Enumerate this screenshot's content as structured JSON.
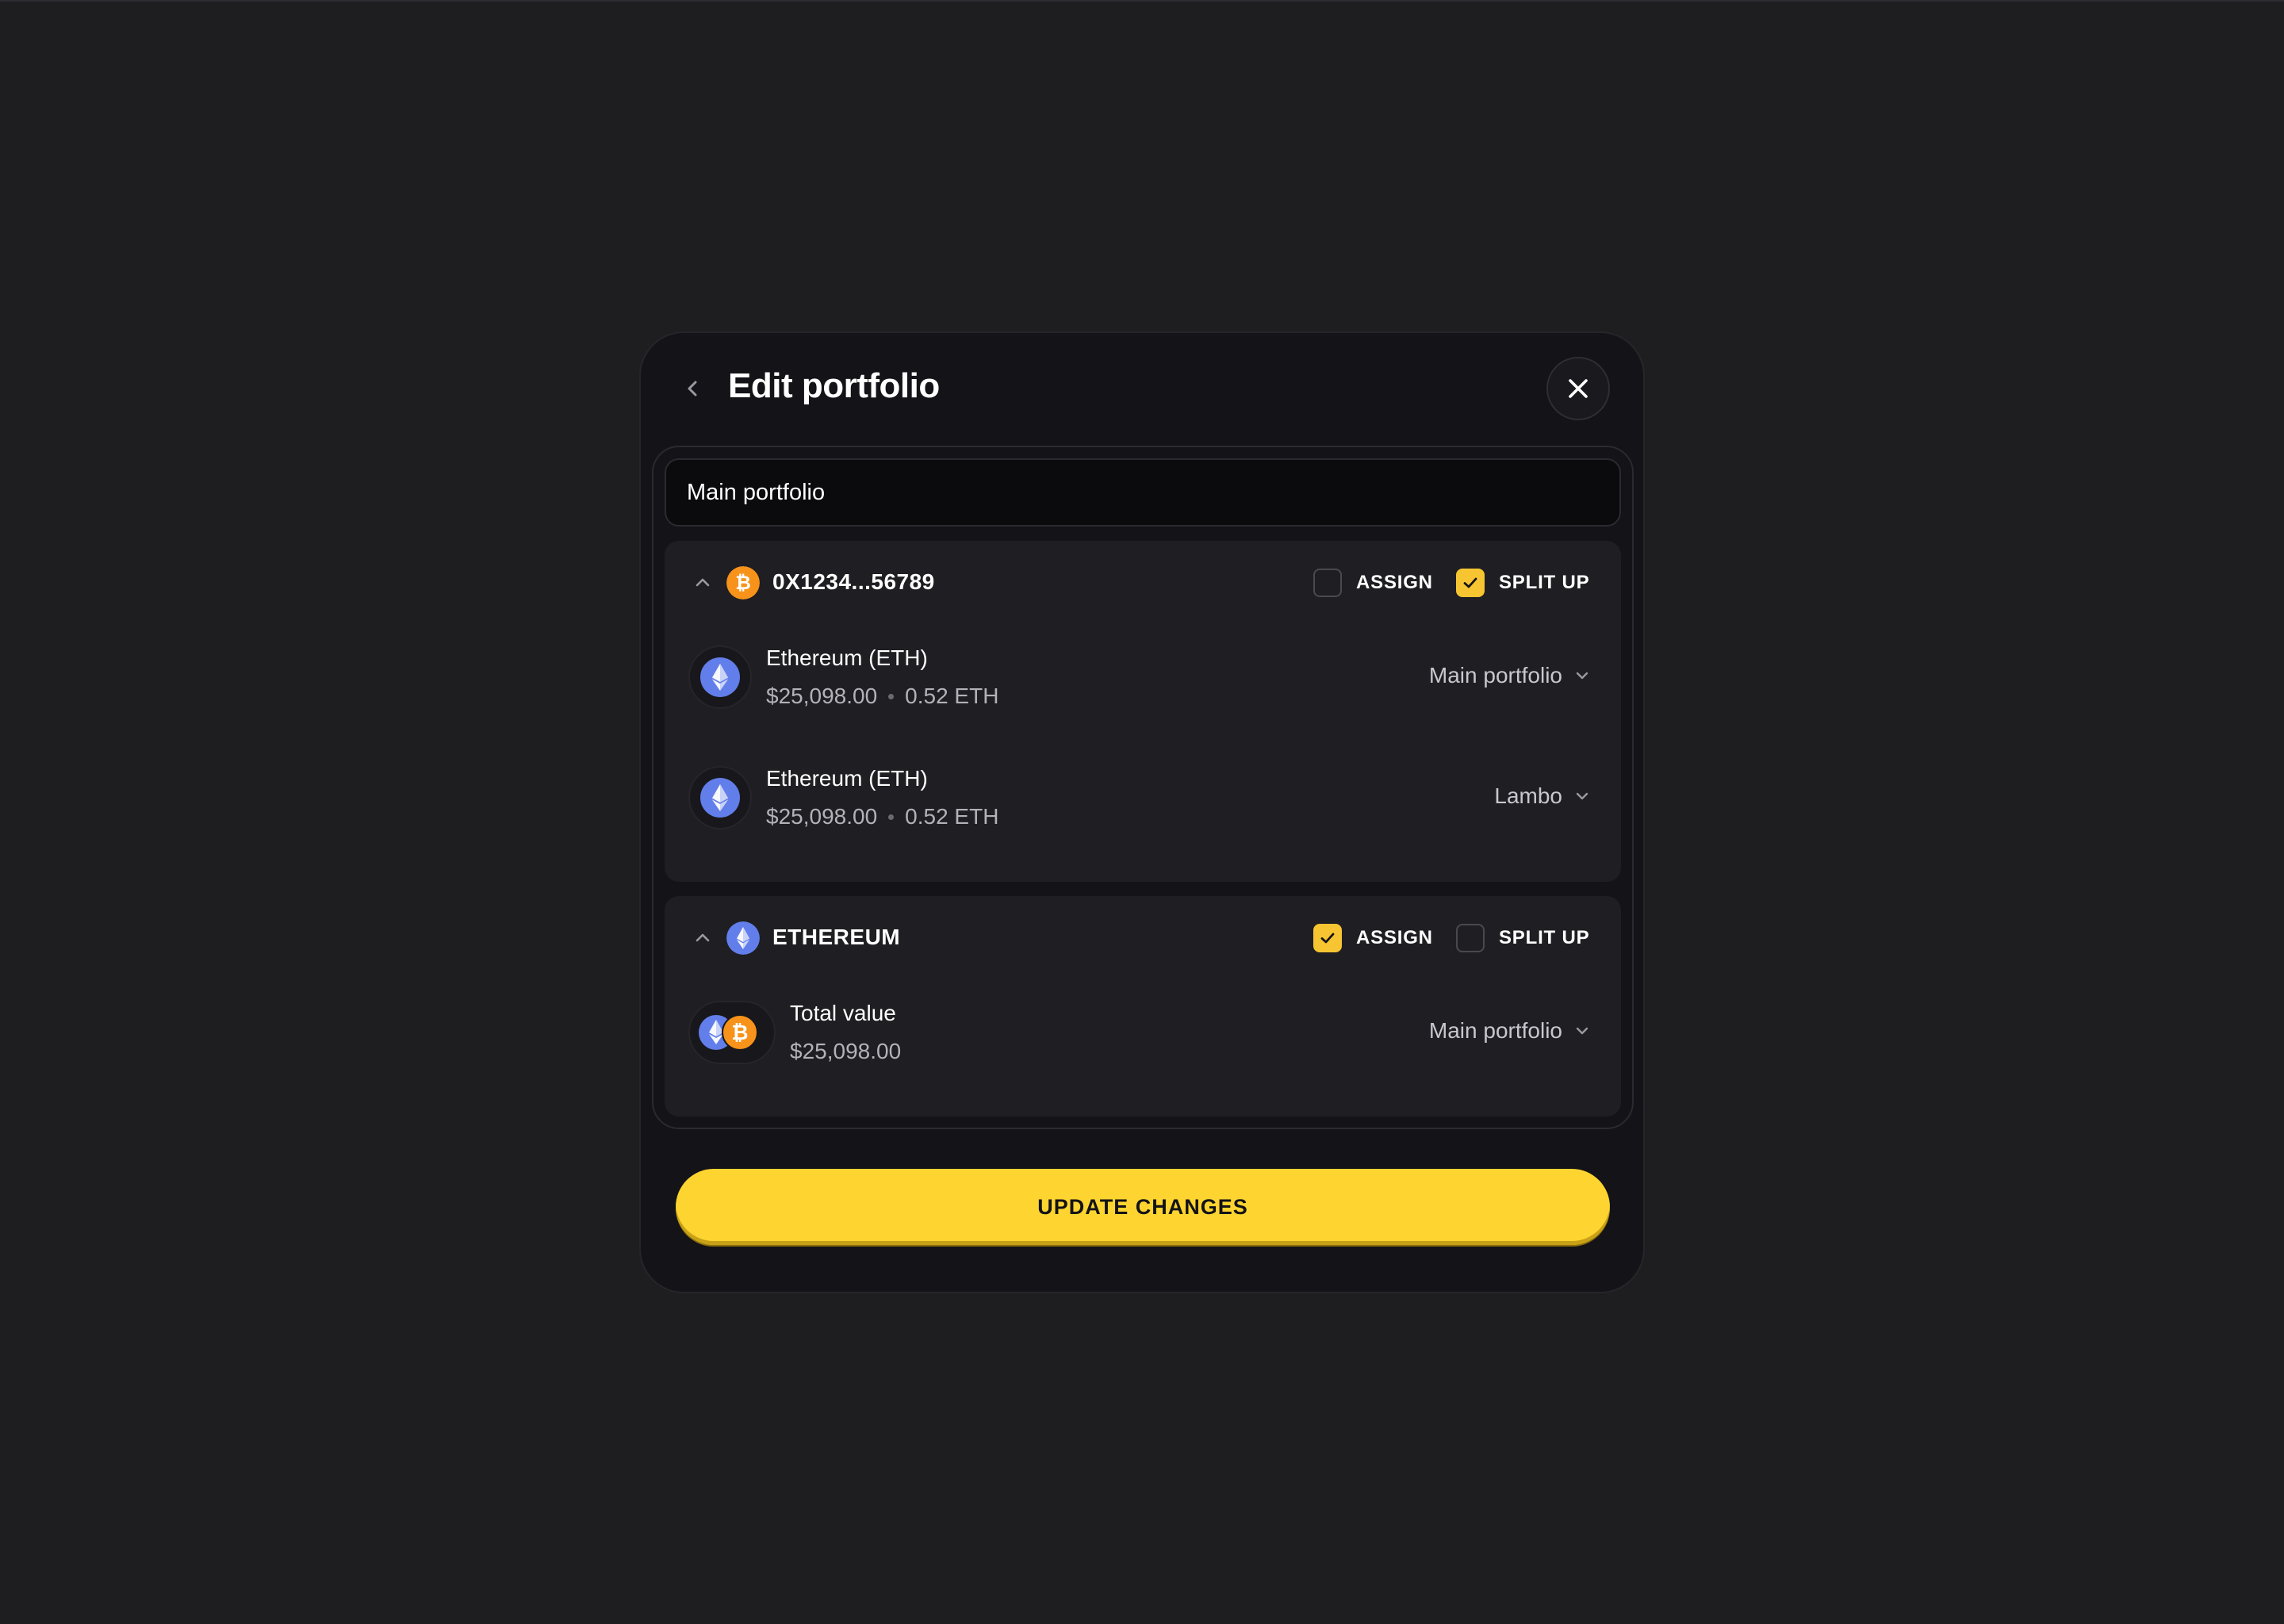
{
  "colors": {
    "background": "#1e1d20",
    "modal": "#141317",
    "accent_yellow": "#fed530",
    "btc_orange": "#f7931a",
    "eth_blue": "#627eea"
  },
  "header": {
    "title": "Edit portfolio",
    "back_icon": "chevron-left-icon",
    "close_icon": "close-icon"
  },
  "portfolio_name": {
    "value": "Main portfolio"
  },
  "groups": [
    {
      "name": "0X1234...56789",
      "coin_icon": "bitcoin-icon",
      "expanded": true,
      "assign": {
        "label": "ASSIGN",
        "checked": false
      },
      "split_up": {
        "label": "SPLIT UP",
        "checked": true
      },
      "rows": [
        {
          "name": "Ethereum (ETH)",
          "value": "$25,098.00",
          "amount": "0.52 ETH",
          "icon": "ethereum-icon",
          "portfolio": "Main portfolio"
        },
        {
          "name": "Ethereum (ETH)",
          "value": "$25,098.00",
          "amount": "0.52 ETH",
          "icon": "ethereum-icon",
          "portfolio": "Lambo"
        }
      ]
    },
    {
      "name": "ETHEREUM",
      "coin_icon": "ethereum-icon",
      "expanded": true,
      "assign": {
        "label": "ASSIGN",
        "checked": true
      },
      "split_up": {
        "label": "SPLIT UP",
        "checked": false
      },
      "rows": [
        {
          "name": "Total value",
          "value": "$25,098.00",
          "icon": "ethereum-bitcoin-pair-icon",
          "portfolio": "Main portfolio"
        }
      ]
    }
  ],
  "footer": {
    "update_label": "UPDATE CHANGES"
  }
}
